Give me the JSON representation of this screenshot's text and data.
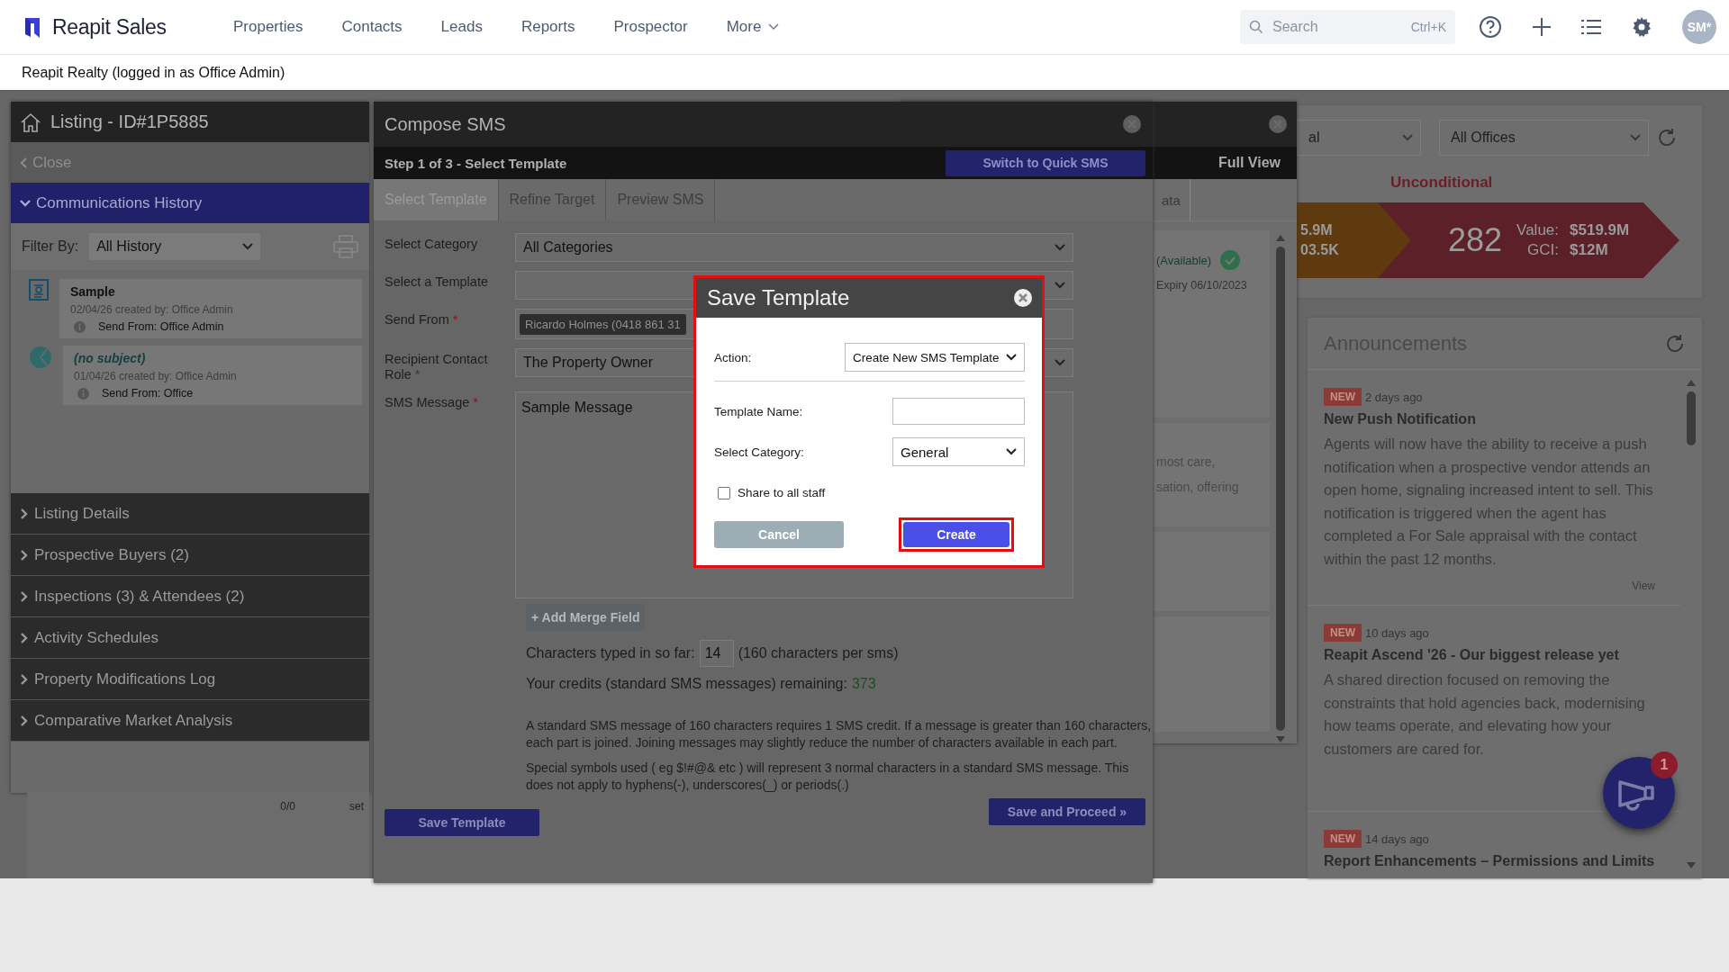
{
  "navbar": {
    "brand": "Reapit Sales",
    "menu": [
      {
        "label": "Properties",
        "kind": "link"
      },
      {
        "label": "Contacts",
        "kind": "link"
      },
      {
        "label": "Leads",
        "kind": "link"
      },
      {
        "label": "Reports",
        "kind": "link"
      },
      {
        "label": "Prospector",
        "kind": "link"
      },
      {
        "label": "More",
        "kind": "dropdown"
      }
    ],
    "search": {
      "placeholder": "Search",
      "shortcut": "Ctrl+K"
    },
    "avatar": "SM*"
  },
  "account_bar": "Reapit Realty (logged in as Office Admin)",
  "listing_panel": {
    "title": "Listing - ID#1P5885",
    "close": "Close",
    "filter": {
      "label": "Filter By:",
      "value": "All History"
    },
    "history": [
      {
        "kind": "letter",
        "subject": "Sample",
        "meta": "02/04/26 created by: Office Admin",
        "send_from": "Send From: Office Admin"
      },
      {
        "kind": "pie",
        "subject": "(no subject)",
        "meta": "01/04/26 created by: Office Admin",
        "send_from": "Send From: Office"
      }
    ],
    "sections": [
      {
        "label": "Communications History",
        "expanded": true
      },
      {
        "label": "Listing Details",
        "expanded": false
      },
      {
        "label": "Prospective Buyers (2)",
        "expanded": false
      },
      {
        "label": "Inspections (3) & Attendees (2)",
        "expanded": false
      },
      {
        "label": "Activity Schedules",
        "expanded": false
      },
      {
        "label": "Property Modifications Log",
        "expanded": false
      },
      {
        "label": "Comparative Market Analysis",
        "expanded": false
      }
    ]
  },
  "behind_panel": {
    "count": "0/0",
    "label": "set"
  },
  "full_view_window": {
    "button": "Full View",
    "tab": "ata",
    "status": "(Available)",
    "expiry": "Expiry 06/10/2023",
    "snippet": [
      "most care,",
      "sation, offering"
    ]
  },
  "compose_sms": {
    "title": "Compose SMS",
    "step": "Step 1 of 3 - Select Template",
    "switch_button": "Switch to Quick SMS",
    "tabs": [
      {
        "label": "Select Template",
        "selected": true
      },
      {
        "label": "Refine Target",
        "selected": false
      },
      {
        "label": "Preview SMS",
        "selected": false
      }
    ],
    "fields": [
      {
        "label": "Select Category",
        "kind": "select",
        "value": "All Categories"
      },
      {
        "label": "Select a Template",
        "kind": "select"
      },
      {
        "label": "Send From",
        "required_mark": "*",
        "kind": "sender",
        "value": "Ricardo Holmes (0418 861 31"
      },
      {
        "label": "Recipient Contact Role",
        "required_mark": "*",
        "kind": "select",
        "value": "The Property Owner"
      },
      {
        "label": "SMS Message",
        "required_mark": "*",
        "kind": "textarea",
        "value": "Sample Message"
      }
    ],
    "add_merge_field": "+ Add Merge Field",
    "chars_label": "Characters typed in so far:",
    "chars_value": "14",
    "chars_note": "(160 characters per sms)",
    "credits_label": "Your credits (standard SMS messages) remaining:",
    "credits_value": "373",
    "notes": [
      "A standard SMS message of 160 characters requires 1 SMS credit. If a message is greater than 160 characters, each part is joined. Joining messages may slightly reduce the number of characters available in each part.",
      "Special symbols used ( eg $!#@& etc ) will represent 3 normal characters in a standard SMS message. This does not apply to hyphens(-), underscores(_) or periods(.)"
    ],
    "save_template": "Save Template",
    "save_proceed": "Save and Proceed »"
  },
  "dashboard": {
    "filters": [
      {
        "value": "al"
      },
      {
        "value": "All Offices"
      }
    ],
    "stage": "Unconditional",
    "banners": [
      {
        "color": "#5f3a0f",
        "lines": [
          {
            "value": "5.9M"
          },
          {
            "value": "03.5K"
          }
        ]
      },
      {
        "color": "#5c2028",
        "count": "282",
        "lines": [
          {
            "label": "Value:",
            "value": "$519.9M"
          },
          {
            "label": "GCI:",
            "value": "$12M"
          }
        ]
      }
    ]
  },
  "announcements": {
    "title": "Announcements",
    "items": [
      {
        "badge": "NEW",
        "age": "2 days ago",
        "title": "New Push Notification",
        "body": "Agents will now have the ability to receive a push notification when a prospective vendor attends an open home, signaling increased intent to sell. This notification is triggered when the agent has completed a For Sale appraisal with the contact within the past 12 months.",
        "link": "View"
      },
      {
        "badge": "NEW",
        "age": "10 days ago",
        "title": "Reapit Ascend '26 - Our biggest release yet",
        "body": "A shared direction focused on removing the constraints that hold agencies back, modernising how teams operate, and elevating how your customers are cared for."
      },
      {
        "badge": "NEW",
        "age": "14 days ago",
        "title": "Report Enhancements – Permissions and Limits"
      }
    ]
  },
  "save_template_dialog": {
    "title": "Save Template",
    "action_label": "Action:",
    "action_value": "Create New SMS Template",
    "name_label": "Template Name:",
    "category_label": "Select Category:",
    "category_value": "General",
    "share_label": "Share to all staff",
    "share_checked": false,
    "cancel": "Cancel",
    "create": "Create"
  },
  "fab": {
    "badge": "1"
  }
}
